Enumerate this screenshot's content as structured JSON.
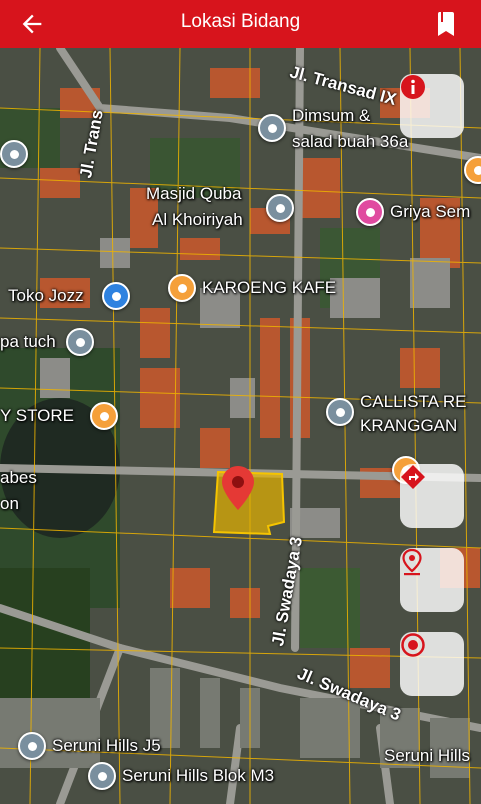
{
  "header": {
    "title": "Lokasi Bidang",
    "background": "#d7141c"
  },
  "icons": {
    "back": "arrow-left-icon",
    "bookmark": "bookmark-icon"
  },
  "places": {
    "dimsum": "Dimsum &",
    "dimsum2": "salad buah 36a",
    "masjid1": "Masjid Quba",
    "masjid2": "Al Khoiriyah",
    "griya": "Griya Sem",
    "toko": "Toko Jozz",
    "karoeng": "KAROENG KAFE",
    "batuch": "pa tuch",
    "ystore": "Y STORE",
    "callista1": "CALLISTA RE",
    "callista2": "KRANGGAN",
    "abes1": "abes",
    "abes2": "on",
    "seruni_j5": "Seruni Hills J5",
    "seruni_m3": "Seruni Hills Blok M3",
    "seruni_r": "Seruni Hills"
  },
  "roads": {
    "transad_ix": "Jl. Transad IX",
    "transad_v": "Jl. Trans",
    "swadaya_v": "Jl. Swadaya 3",
    "swadaya_h": "Jl. Swadaya 3"
  },
  "parcel": {
    "highlight_color": "#e6b400",
    "pin_color": "#e53935"
  },
  "controls": [
    "info-button",
    "directions-button",
    "location-pin-button",
    "target-button"
  ]
}
